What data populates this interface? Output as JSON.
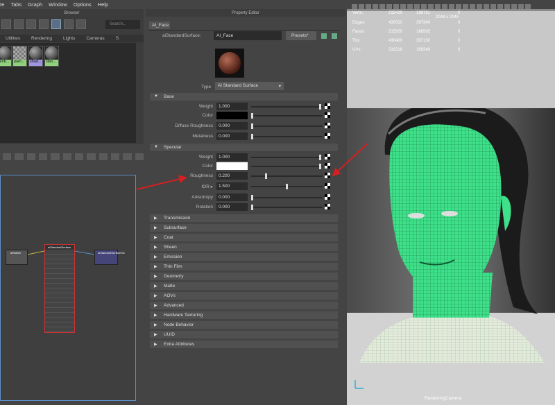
{
  "menubar": [
    "ate",
    "Tabs",
    "Graph",
    "Window",
    "Options",
    "Help"
  ],
  "browser": {
    "title": "Browser",
    "search_placeholder": "Search...",
    "tabs": [
      "Utilities",
      "Rendering",
      "Lights",
      "Cameras",
      "S"
    ],
    "swatches": [
      {
        "label": "amb..."
      },
      {
        "label": "parti..."
      },
      {
        "label": "shad..."
      },
      {
        "label": "stan..."
      }
    ]
  },
  "graph_nodes": [
    "aiSwitch",
    "aiStandardSurface",
    "aiStandardSurfaceSG"
  ],
  "property_editor": {
    "title": "Property Editor",
    "tab": "AI_Face",
    "node_type_label": "aiStandardSurface:",
    "node_name": "AI_Face",
    "presets": "Presets*",
    "type_label": "Type",
    "type_value": "Ai Standard Surface",
    "sections_open": [
      {
        "name": "Base",
        "attrs": [
          {
            "label": "Weight",
            "value": "1.000"
          },
          {
            "label": "Color",
            "value": ""
          },
          {
            "label": "Diffuse Roughness",
            "value": "0.000"
          },
          {
            "label": "Metalness",
            "value": "0.000"
          }
        ]
      },
      {
        "name": "Specular",
        "attrs": [
          {
            "label": "Weight",
            "value": "1.000"
          },
          {
            "label": "Color",
            "value": ""
          },
          {
            "label": "Roughness",
            "value": "0.200"
          },
          {
            "label": "IOR ▸",
            "value": "1.500"
          },
          {
            "label": "Anisotropy",
            "value": "0.000"
          },
          {
            "label": "Rotation",
            "value": "0.000"
          }
        ]
      }
    ],
    "sections_closed": [
      "Transmission",
      "Subsurface",
      "Coat",
      "Sheen",
      "Emission",
      "Thin Film",
      "Geometry",
      "Matte",
      "AOVs",
      "Advanced",
      "Hardware Texturing",
      "Node Behavior",
      "UUID",
      "Extra Attributes"
    ]
  },
  "viewport": {
    "resolution": "2048 x 2048",
    "camera": "RenderingCamera",
    "stats": [
      {
        "label": "Verts:",
        "a": "215429",
        "b": "198781",
        "c": "0"
      },
      {
        "label": "Edges:",
        "a": "430520",
        "b": "397340",
        "c": "0"
      },
      {
        "label": "Faces:",
        "a": "215200",
        "b": "198565",
        "c": "0"
      },
      {
        "label": "Tris:",
        "a": "430400",
        "b": "397130",
        "c": "0"
      },
      {
        "label": "UVs:",
        "a": "216218",
        "b": "199349",
        "c": "0"
      }
    ]
  },
  "colors": {
    "accent": "#5c8ec9",
    "wireframe": "#3ee08a",
    "arrow": "#d42020"
  }
}
